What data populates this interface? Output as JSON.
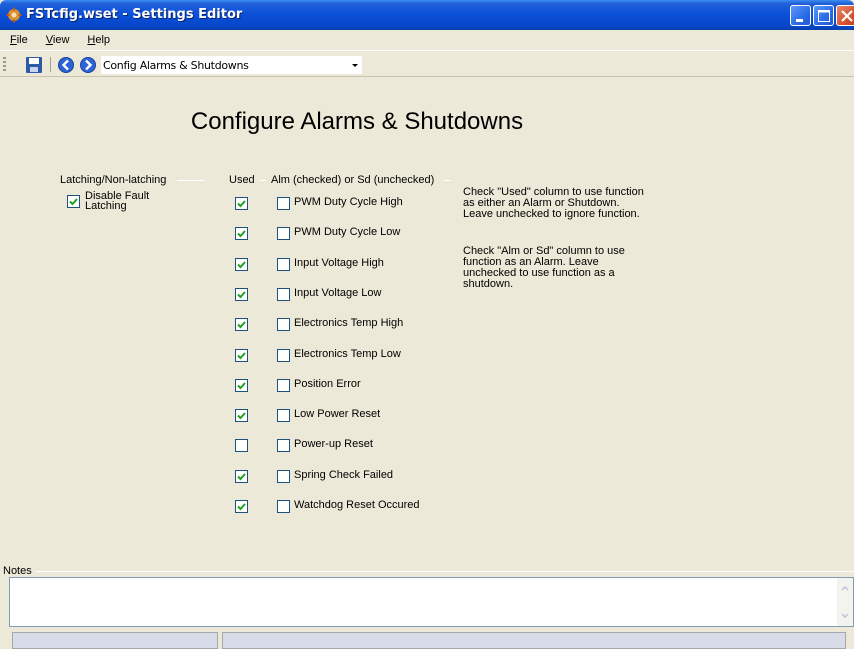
{
  "window": {
    "title": "FSTcfig.wset - Settings Editor"
  },
  "menu": {
    "file": {
      "first": "F",
      "rest": "ile"
    },
    "view": {
      "first": "V",
      "rest": "iew"
    },
    "help": {
      "first": "H",
      "rest": "elp"
    }
  },
  "toolbar": {
    "page_select_value": "Config Alarms & Shutdowns"
  },
  "main": {
    "title": "Configure Alarms & Shutdowns",
    "headers": {
      "latching": "Latching/Non-latching",
      "used": "Used",
      "alm_sd": "Alm (checked) or Sd (unchecked)"
    },
    "latching_option": {
      "label_line1": "Disable Fault",
      "label_line2": "Latching",
      "checked": true
    },
    "functions": [
      {
        "label": "PWM Duty Cycle High",
        "used": true,
        "alarm": false
      },
      {
        "label": "PWM Duty Cycle Low",
        "used": true,
        "alarm": false
      },
      {
        "label": "Input Voltage High",
        "used": true,
        "alarm": false
      },
      {
        "label": "Input Voltage Low",
        "used": true,
        "alarm": false
      },
      {
        "label": "Electronics Temp High",
        "used": true,
        "alarm": false
      },
      {
        "label": "Electronics Temp Low",
        "used": true,
        "alarm": false
      },
      {
        "label": "Position Error",
        "used": true,
        "alarm": false
      },
      {
        "label": "Low Power Reset",
        "used": true,
        "alarm": false
      },
      {
        "label": "Power-up Reset",
        "used": false,
        "alarm": false
      },
      {
        "label": "Spring Check Failed",
        "used": true,
        "alarm": false
      },
      {
        "label": "Watchdog Reset Occured",
        "used": true,
        "alarm": false
      }
    ],
    "help_text": {
      "used": [
        "Check \"Used\" column to use function",
        "as either an Alarm or Shutdown.",
        "Leave unchecked to ignore function."
      ],
      "alm_sd": [
        "Check \"Alm or Sd\" column to use",
        "function as an Alarm. Leave",
        "unchecked to use function as a",
        "shutdown."
      ]
    }
  },
  "notes": {
    "label": "Notes",
    "value": ""
  },
  "colors": {
    "titlebar": "#0A4FD8",
    "window_bg": "#ECE9D8",
    "checkbox_border": "#1C5180",
    "checkmark": "#21A121"
  }
}
